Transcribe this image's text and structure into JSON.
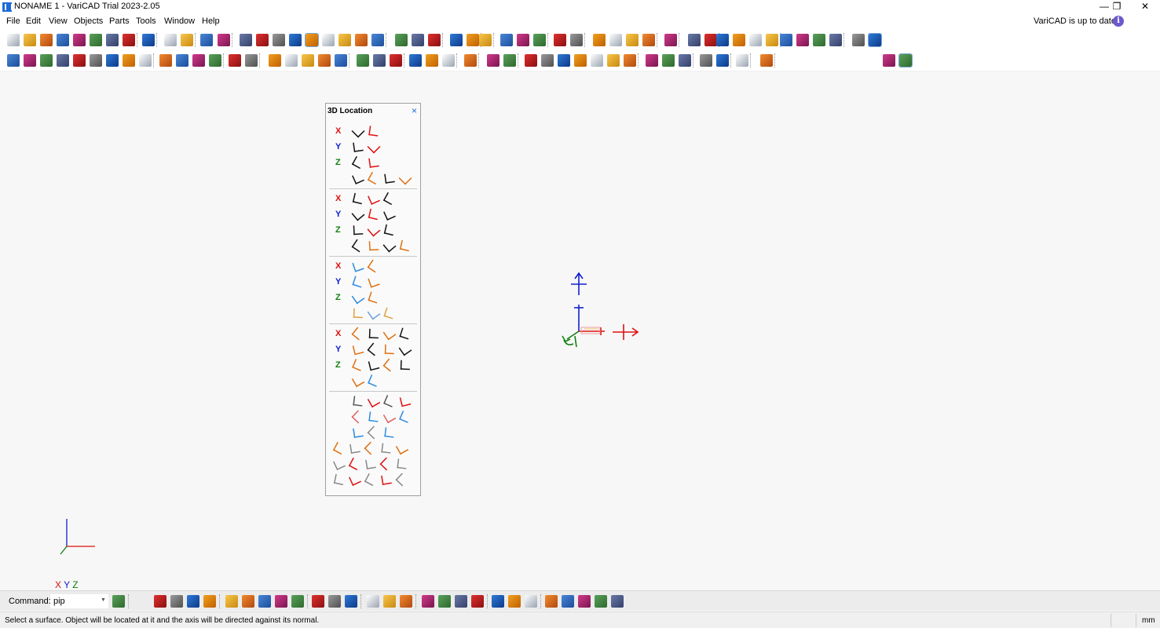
{
  "window": {
    "title": "NONAME 1 - VariCAD Trial 2023-2.05",
    "minimize_glyph": "—",
    "restore_glyph": "❐",
    "close_glyph": "✕"
  },
  "menu": {
    "items": [
      "File",
      "Edit",
      "View",
      "Objects",
      "Parts",
      "Tools",
      "Window",
      "Help"
    ],
    "update_status": "VariCAD is up to date",
    "info_glyph": "i"
  },
  "panel": {
    "title": "3D Location",
    "close_glyph": "×",
    "axis_labels": [
      "X",
      "Y",
      "Z"
    ]
  },
  "command": {
    "label": "Command:",
    "value": "pip",
    "dropdown_glyph": "▼"
  },
  "status": {
    "message": "Select a surface. Object will be located at it and the axis will be directed against its normal.",
    "unit": "mm"
  },
  "axis_legend": {
    "x": "X",
    "y": "Y",
    "z": "Z"
  },
  "colors": {
    "x_axis": "#e01010",
    "y_axis": "#1020d0",
    "z_axis": "#108010",
    "accent": "#1e6bd6"
  }
}
